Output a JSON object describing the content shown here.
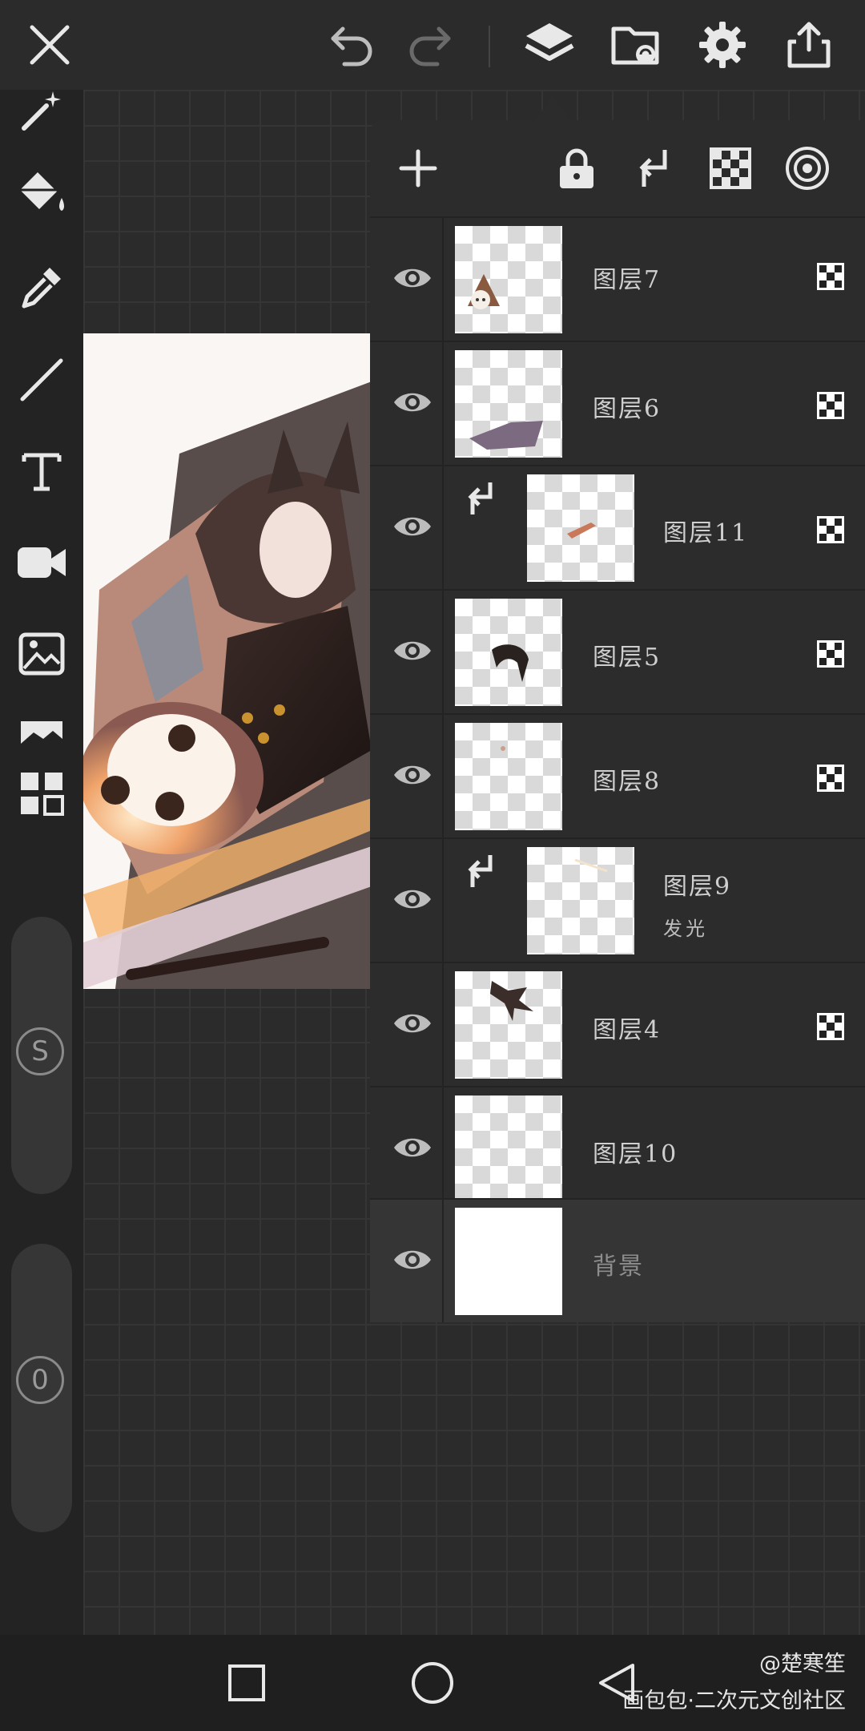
{
  "layers_panel": {
    "layers": [
      {
        "name": "图层7",
        "visible": true,
        "clipped": false,
        "alpha_locked": true
      },
      {
        "name": "图层6",
        "visible": true,
        "clipped": false,
        "alpha_locked": true
      },
      {
        "name": "图层11",
        "visible": true,
        "clipped": true,
        "alpha_locked": true
      },
      {
        "name": "图层5",
        "visible": true,
        "clipped": false,
        "alpha_locked": true
      },
      {
        "name": "图层8",
        "visible": true,
        "clipped": false,
        "alpha_locked": true
      },
      {
        "name": "图层9",
        "mode": "发光",
        "visible": true,
        "clipped": true,
        "alpha_locked": false
      },
      {
        "name": "图层4",
        "visible": true,
        "clipped": false,
        "alpha_locked": true
      },
      {
        "name": "图层10",
        "visible": true,
        "clipped": false,
        "alpha_locked": false
      },
      {
        "name": "背景",
        "visible": true,
        "clipped": false,
        "alpha_locked": false,
        "selected": true
      }
    ]
  },
  "left_toolbar": {
    "brush_size_badge": "S",
    "opacity_badge": "0"
  },
  "watermark": {
    "author": "@楚寒笙",
    "site": "画包包·二次元文创社区"
  },
  "colors": {
    "panel_bg": "#2c2c2c",
    "toolbar_bg": "#2b2b2b",
    "icon": "#e8e8e8"
  }
}
